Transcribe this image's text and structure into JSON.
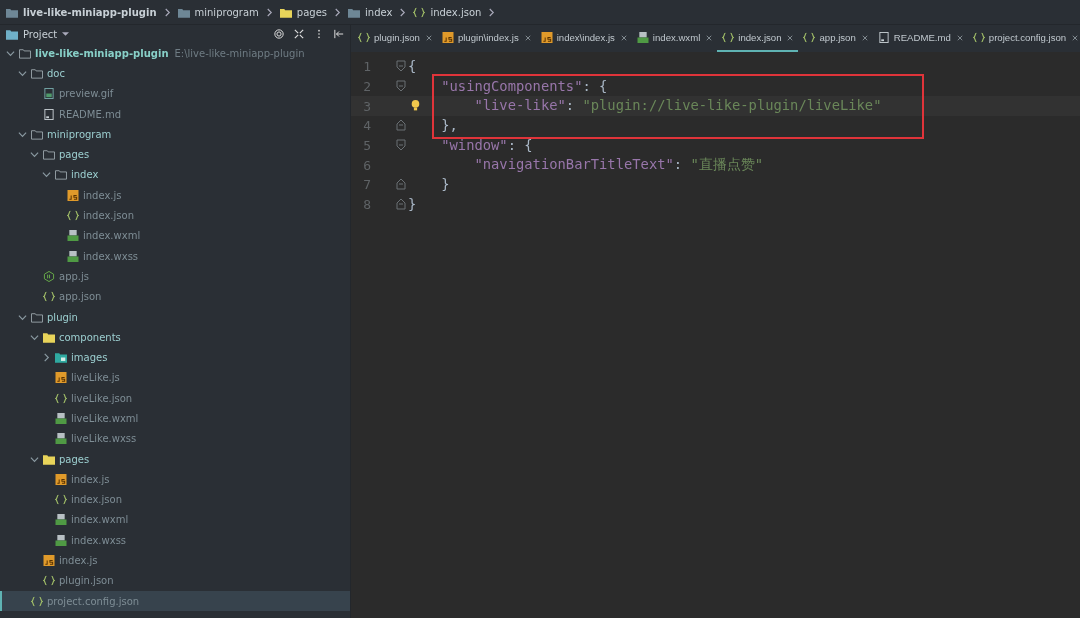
{
  "breadcrumb": [
    {
      "kind": "folder",
      "label": "live-like-miniapp-plugin"
    },
    {
      "kind": "folder",
      "label": "miniprogram"
    },
    {
      "kind": "yellow-folder",
      "label": "pages"
    },
    {
      "kind": "folder",
      "label": "index"
    },
    {
      "kind": "json",
      "label": "index.json"
    }
  ],
  "sidebar": {
    "view": "Project",
    "tree": [
      {
        "kind": "folder",
        "label": "live-like-miniapp-plugin",
        "path": "E:\\live-like-miniapp-plugin",
        "expanded": true,
        "selected": false,
        "children": [
          {
            "kind": "folder",
            "label": "doc",
            "expanded": true,
            "selected": false,
            "children": [
              {
                "kind": "gif",
                "label": "preview.gif",
                "selected": false
              },
              {
                "kind": "md",
                "label": "README.md",
                "selected": false
              }
            ]
          },
          {
            "kind": "folder",
            "label": "miniprogram",
            "expanded": true,
            "selected": false,
            "children": [
              {
                "kind": "folder",
                "label": "pages",
                "expanded": true,
                "selected": false,
                "children": [
                  {
                    "kind": "folder",
                    "label": "index",
                    "expanded": true,
                    "selected": false,
                    "children": [
                      {
                        "kind": "js",
                        "label": "index.js",
                        "selected": false
                      },
                      {
                        "kind": "json",
                        "label": "index.json",
                        "selected": false
                      },
                      {
                        "kind": "wxml",
                        "label": "index.wxml",
                        "selected": false
                      },
                      {
                        "kind": "wxml",
                        "label": "index.wxss",
                        "selected": false
                      }
                    ]
                  }
                ]
              },
              {
                "kind": "node",
                "label": "app.js",
                "selected": false
              },
              {
                "kind": "json",
                "label": "app.json",
                "selected": false
              }
            ]
          },
          {
            "kind": "folder",
            "label": "plugin",
            "expanded": true,
            "selected": false,
            "children": [
              {
                "kind": "yellow-folder",
                "label": "components",
                "expanded": true,
                "selected": false,
                "children": [
                  {
                    "kind": "image-folder",
                    "label": "images",
                    "expanded": false,
                    "selected": false
                  },
                  {
                    "kind": "js",
                    "label": "liveLike.js",
                    "selected": false
                  },
                  {
                    "kind": "json",
                    "label": "liveLike.json",
                    "selected": false
                  },
                  {
                    "kind": "wxml",
                    "label": "liveLike.wxml",
                    "selected": false
                  },
                  {
                    "kind": "wxml",
                    "label": "liveLike.wxss",
                    "selected": false
                  }
                ]
              },
              {
                "kind": "yellow-folder",
                "label": "pages",
                "expanded": true,
                "selected": false,
                "children": [
                  {
                    "kind": "js",
                    "label": "index.js",
                    "selected": false
                  },
                  {
                    "kind": "json",
                    "label": "index.json",
                    "selected": false
                  },
                  {
                    "kind": "wxml",
                    "label": "index.wxml",
                    "selected": false
                  },
                  {
                    "kind": "wxml",
                    "label": "index.wxss",
                    "selected": false
                  }
                ]
              },
              {
                "kind": "js",
                "label": "index.js",
                "selected": false
              },
              {
                "kind": "json",
                "label": "plugin.json",
                "selected": false
              }
            ]
          },
          {
            "kind": "json",
            "label": "project.config.json",
            "selected": true
          }
        ]
      }
    ]
  },
  "tabs": [
    {
      "kind": "json",
      "label": "plugin.json",
      "selected": false
    },
    {
      "kind": "js",
      "label": "plugin\\index.js",
      "selected": false
    },
    {
      "kind": "js",
      "label": "index\\index.js",
      "selected": false
    },
    {
      "kind": "wxml",
      "label": "index.wxml",
      "selected": false
    },
    {
      "kind": "json",
      "label": "index.json",
      "selected": true
    },
    {
      "kind": "json",
      "label": "app.json",
      "selected": false
    },
    {
      "kind": "md",
      "label": "README.md",
      "selected": false
    },
    {
      "kind": "json",
      "label": "project.config.json",
      "selected": false
    }
  ],
  "editor": {
    "lines": [
      {
        "number": "1",
        "fold_start": true,
        "fold_end": false,
        "boxed": false,
        "current": false,
        "tokens": [
          {
            "kind": "punct",
            "text": "{"
          }
        ]
      },
      {
        "number": "2",
        "fold_start": true,
        "fold_end": false,
        "boxed": true,
        "current": false,
        "tokens": [
          {
            "kind": "key",
            "text": "    \"usingComponents\""
          },
          {
            "kind": "punct",
            "text": ": {"
          }
        ]
      },
      {
        "number": "3",
        "fold_start": false,
        "fold_end": false,
        "boxed": true,
        "current": true,
        "tokens": [
          {
            "kind": "key",
            "text": "        \"live-like\""
          },
          {
            "kind": "punct",
            "text": ": "
          },
          {
            "kind": "string",
            "text": "\"plugin://live-like-plugin/liveLike\""
          }
        ]
      },
      {
        "number": "4",
        "fold_start": false,
        "fold_end": true,
        "boxed": true,
        "current": false,
        "tokens": [
          {
            "kind": "punct",
            "text": "    },"
          }
        ]
      },
      {
        "number": "5",
        "fold_start": true,
        "fold_end": false,
        "boxed": false,
        "current": false,
        "tokens": [
          {
            "kind": "key",
            "text": "    \"window\""
          },
          {
            "kind": "punct",
            "text": ": {"
          }
        ]
      },
      {
        "number": "6",
        "fold_start": false,
        "fold_end": false,
        "boxed": false,
        "current": false,
        "tokens": [
          {
            "kind": "key",
            "text": "        \"navigationBarTitleText\""
          },
          {
            "kind": "punct",
            "text": ": "
          },
          {
            "kind": "string",
            "text": "\"直播点赞\""
          }
        ]
      },
      {
        "number": "7",
        "fold_start": false,
        "fold_end": true,
        "boxed": false,
        "current": false,
        "tokens": [
          {
            "kind": "punct",
            "text": "    }"
          }
        ]
      },
      {
        "number": "8",
        "fold_start": false,
        "fold_end": true,
        "boxed": false,
        "current": false,
        "tokens": [
          {
            "kind": "punct",
            "text": "}"
          }
        ]
      }
    ]
  }
}
